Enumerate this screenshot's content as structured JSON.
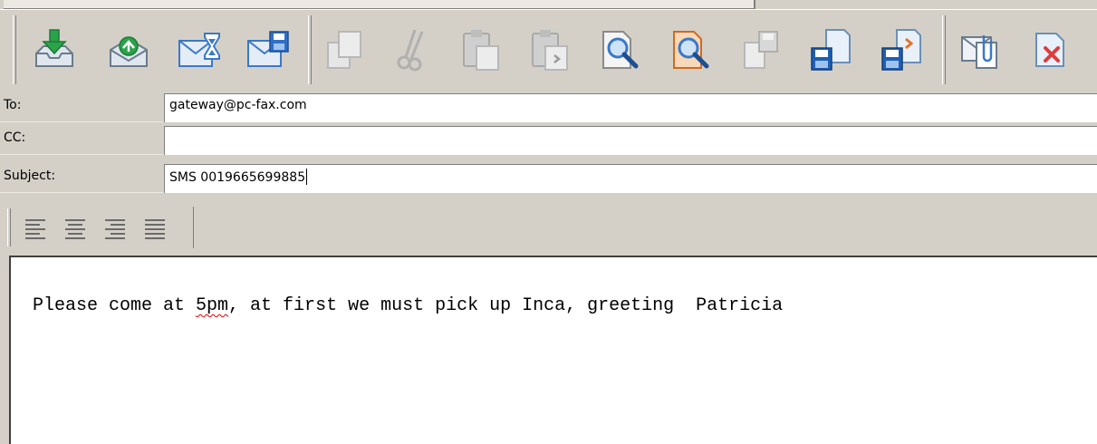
{
  "toolbar": {
    "buttons": [
      {
        "icon": "inbox-receive-icon",
        "enabled": true,
        "accent": "#2aa34a"
      },
      {
        "icon": "outbox-send-icon",
        "enabled": true,
        "accent": "#2aa34a"
      },
      {
        "icon": "mail-timer-icon",
        "enabled": true,
        "accent": "#3a78c8"
      },
      {
        "icon": "mail-save-icon",
        "enabled": true,
        "accent": "#3a78c8"
      },
      {
        "icon": "copy-icon",
        "enabled": false
      },
      {
        "icon": "cut-icon",
        "enabled": false
      },
      {
        "icon": "paste-icon",
        "enabled": false
      },
      {
        "icon": "paste-special-icon",
        "enabled": false
      },
      {
        "icon": "search-icon",
        "enabled": true,
        "accent": "#3a78c8"
      },
      {
        "icon": "search-advanced-icon",
        "enabled": true,
        "accent": "#e0752a"
      },
      {
        "icon": "save-disabled-icon",
        "enabled": false
      },
      {
        "icon": "save-document-icon",
        "enabled": true,
        "accent": "#1f5fb4"
      },
      {
        "icon": "save-export-icon",
        "enabled": true,
        "accent": "#1f5fb4"
      },
      {
        "icon": "attach-icon",
        "enabled": true,
        "accent": "#3a78c8"
      },
      {
        "icon": "delete-document-icon",
        "enabled": true,
        "accent": "#e03a3a"
      }
    ]
  },
  "fields": {
    "to": {
      "label": "To:",
      "value": "gateway@pc-fax.com"
    },
    "cc": {
      "label": "CC:",
      "value": ""
    },
    "subject": {
      "label": "Subject:",
      "value": "SMS 0019665699885"
    }
  },
  "format": {
    "buttons": [
      "align-left-icon",
      "align-center-icon",
      "align-right-icon",
      "align-justify-icon"
    ]
  },
  "body": {
    "before": "Please come at ",
    "misspelled": "5pm",
    "after": ", at first we must pick up Inca, greeting  Patricia"
  },
  "colors": {
    "misspell_underline": "#e00000",
    "window_bg": "#d4d0c8"
  }
}
